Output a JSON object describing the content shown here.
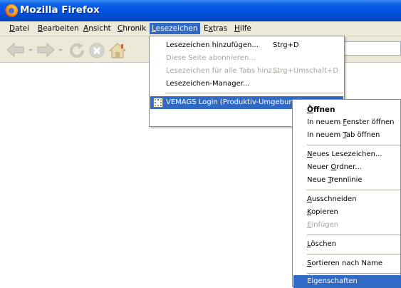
{
  "window": {
    "title": "Mozilla Firefox"
  },
  "menubar": {
    "items": [
      {
        "label": "Datei",
        "underline": "D"
      },
      {
        "label": "Bearbeiten",
        "underline": "B"
      },
      {
        "label": "Ansicht",
        "underline": "A"
      },
      {
        "label": "Chronik",
        "underline": "C"
      },
      {
        "label": "Lesezeichen",
        "underline": "L",
        "active": true
      },
      {
        "label": "Extras",
        "underline": "x"
      },
      {
        "label": "Hilfe",
        "underline": "H"
      }
    ]
  },
  "bookmarks_menu": {
    "items": [
      {
        "label": "Lesezeichen hinzufügen...",
        "shortcut": "Strg+D",
        "disabled": false
      },
      {
        "label": "Diese Seite abonnieren...",
        "shortcut": "",
        "disabled": true
      },
      {
        "label": "Lesezeichen für alle Tabs hinz...",
        "shortcut": "Strg+Umschalt+D",
        "disabled": true
      },
      {
        "label": "Lesezeichen-Manager...",
        "shortcut": "",
        "disabled": false
      }
    ],
    "bookmark": {
      "label": "VEMAGS Login (Produktiv-Umgebung)",
      "icon": "bookmark-favicon"
    }
  },
  "context_menu": {
    "items": [
      {
        "label": "Öffnen",
        "underline": "Ö",
        "bold": true
      },
      {
        "label": "In neuem Fenster öffnen",
        "underline": "F"
      },
      {
        "label": "In neuem Tab öffnen",
        "underline": "T"
      },
      {
        "label": "Neues Lesezeichen...",
        "underline": "N"
      },
      {
        "label": "Neuer Ordner...",
        "underline": "O"
      },
      {
        "label": "Neue Trennlinie",
        "underline": "T"
      },
      {
        "label": "Ausschneiden",
        "underline": "A"
      },
      {
        "label": "Kopieren",
        "underline": "K"
      },
      {
        "label": "Einfügen",
        "underline": "E",
        "disabled": true
      },
      {
        "label": "Löschen",
        "underline": "L"
      },
      {
        "label": "Sortieren nach Name",
        "underline": "S"
      },
      {
        "label": "Eigenschaften",
        "underline": "g",
        "highlighted": true
      }
    ]
  },
  "colors": {
    "titlebar": "#0053e0",
    "highlight": "#316ac5",
    "chrome": "#ece9d8",
    "disabled": "#a7a69d"
  }
}
